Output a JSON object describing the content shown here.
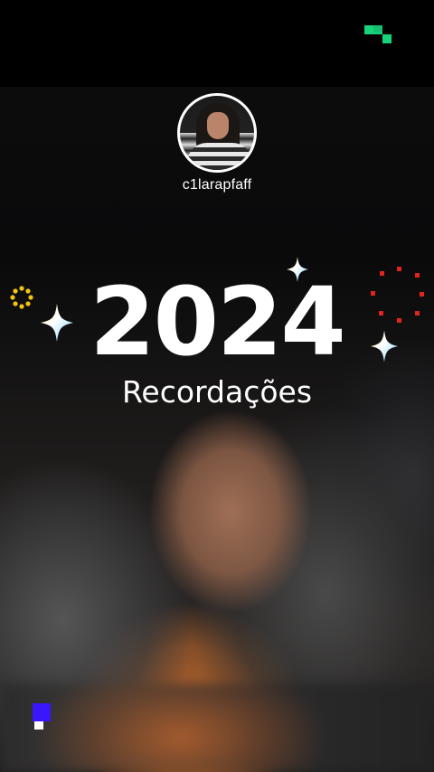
{
  "profile": {
    "username": "c1larapfaff"
  },
  "title": {
    "year": "2024",
    "subtitle": "Recordações"
  },
  "colors": {
    "background": "#000000",
    "text": "#ffffff",
    "accent_green": "#17d37a",
    "accent_blue": "#3a16ff",
    "accent_yellow": "#f4c414",
    "accent_red": "#e0261c"
  },
  "decorations": [
    "pixel-green-icon",
    "sparkle-icon",
    "sun-dots-icon",
    "red-dots-ring-icon",
    "pixel-blue-icon"
  ]
}
